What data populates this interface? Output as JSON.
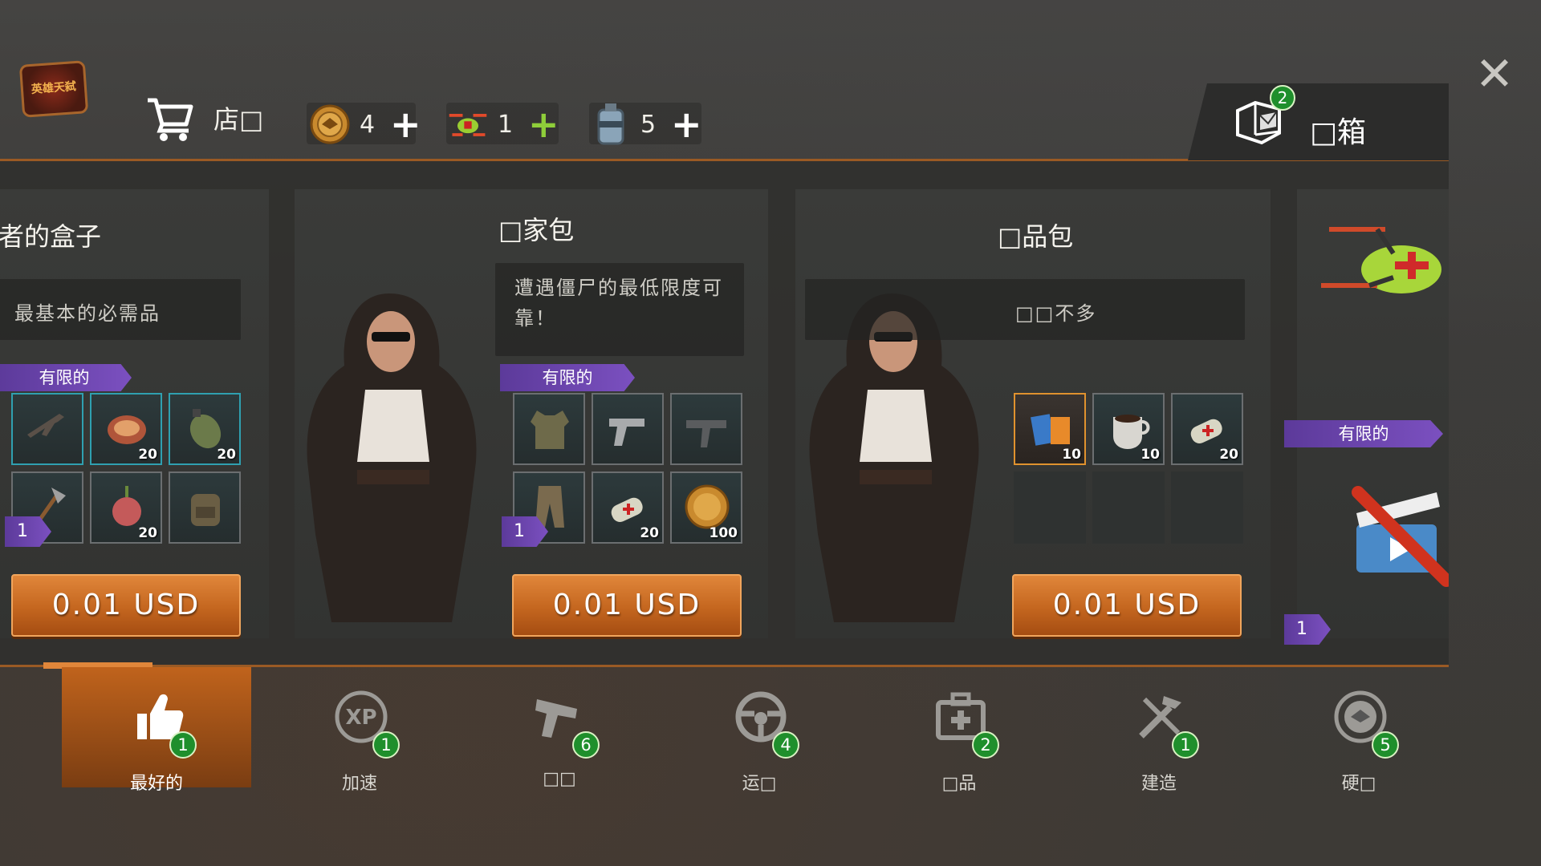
{
  "logo": {
    "text": "英雄天弑"
  },
  "header": {
    "shop_label": "店□",
    "resources": [
      {
        "icon": "coin-icon",
        "value": "4"
      },
      {
        "icon": "drone-icon",
        "value": "1"
      },
      {
        "icon": "canister-icon",
        "value": "5"
      }
    ],
    "crate_label": "□箱",
    "crate_badge": "2",
    "close_icon": "close-icon"
  },
  "cards": [
    {
      "title": "者的盒子",
      "description": "最基本的必需品",
      "ribbon": "有限的",
      "count": "1",
      "price": "0.01 USD",
      "items": [
        {
          "icon": "rifle-icon",
          "qty": ""
        },
        {
          "icon": "steak-icon",
          "qty": "20"
        },
        {
          "icon": "canteen-icon",
          "qty": "20"
        },
        {
          "icon": "axe-icon",
          "qty": ""
        },
        {
          "icon": "onion-icon",
          "qty": "20"
        },
        {
          "icon": "backpack-icon",
          "qty": ""
        }
      ]
    },
    {
      "title": "□家包",
      "description": "遭遇僵尸的最低限度可靠！",
      "ribbon": "有限的",
      "count": "1",
      "price": "0.01 USD",
      "items": [
        {
          "icon": "vest-icon",
          "qty": ""
        },
        {
          "icon": "pistol-icon",
          "qty": ""
        },
        {
          "icon": "uzi-icon",
          "qty": ""
        },
        {
          "icon": "pants-icon",
          "qty": ""
        },
        {
          "icon": "bandage-icon",
          "qty": "20"
        },
        {
          "icon": "coin-icon",
          "qty": "100"
        }
      ]
    },
    {
      "title": "□品包",
      "description": "□□不多",
      "price": "0.01 USD",
      "items": [
        {
          "icon": "snack-icon",
          "qty": "10"
        },
        {
          "icon": "coffee-icon",
          "qty": "10"
        },
        {
          "icon": "bandage-icon",
          "qty": "20"
        }
      ]
    },
    {
      "ribbon": "有限的",
      "count": "1"
    }
  ],
  "nav": [
    {
      "label": "最好的",
      "badge": "1",
      "icon": "thumbs-up-icon"
    },
    {
      "label": "加速",
      "badge": "1",
      "icon": "xp-icon"
    },
    {
      "label": "□□",
      "badge": "6",
      "icon": "pistol-icon"
    },
    {
      "label": "运□",
      "badge": "4",
      "icon": "steering-wheel-icon"
    },
    {
      "label": "□品",
      "badge": "2",
      "icon": "medkit-icon"
    },
    {
      "label": "建造",
      "badge": "1",
      "icon": "tools-icon"
    },
    {
      "label": "硬□",
      "badge": "5",
      "icon": "coin-icon"
    }
  ],
  "colors": {
    "accent": "#c4661f",
    "ribbon": "#6b45b0",
    "badge": "#1f8f2c"
  }
}
